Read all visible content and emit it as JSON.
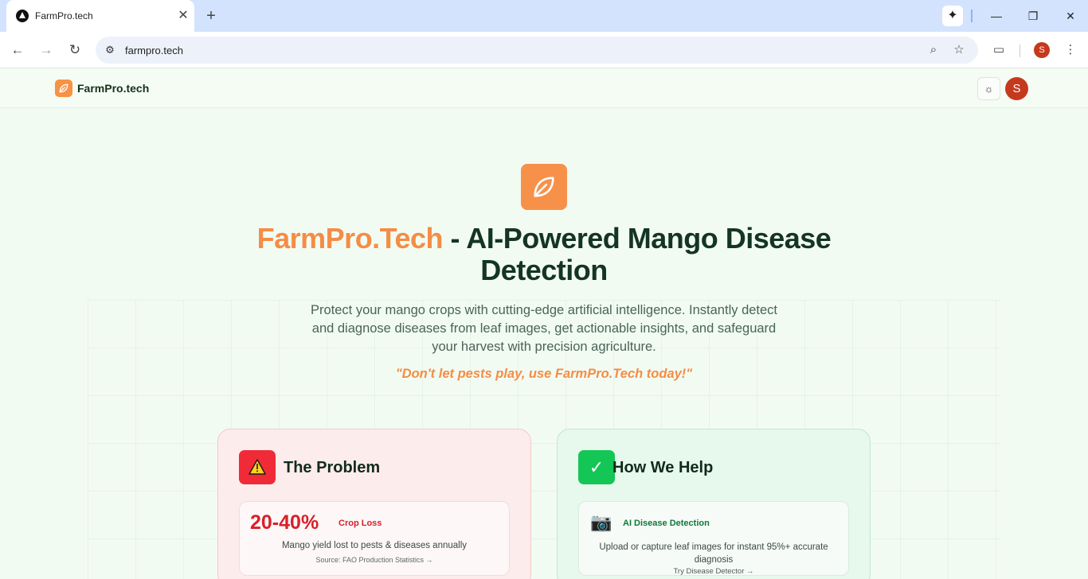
{
  "browser": {
    "tab_title": "FarmPro.tech",
    "tab_close": "✕",
    "new_tab": "+",
    "url": "farmpro.tech",
    "profile_initial": "S",
    "icons": [
      "favicon-icon",
      "close-icon",
      "plus-icon",
      "gemini-icon",
      "minimize-icon",
      "restore-icon",
      "close-window-icon",
      "back-icon",
      "forward-icon",
      "reload-icon",
      "site-info-icon",
      "zoom-icon",
      "bookmark-star-icon",
      "tab-search-icon",
      "kebab-menu-icon"
    ]
  },
  "header": {
    "brand": "FarmPro.tech",
    "avatar_initial": "S",
    "icons": [
      "leaf-icon",
      "sun-icon"
    ]
  },
  "hero": {
    "title_accent": "FarmPro.Tech",
    "title_rest": " - AI-Powered Mango Disease Detection",
    "description": "Protect your mango crops with cutting-edge artificial intelligence. Instantly detect and diagnose diseases from leaf images, get actionable insights, and safeguard your harvest with precision agriculture.",
    "quote": "\"Don't let pests play, use FarmPro.Tech today!\""
  },
  "problem": {
    "title": "The Problem",
    "stat_value": "20-40%",
    "stat_label": "Crop Loss",
    "stat_desc": "Mango yield lost to pests & diseases annually",
    "stat_source": "Source: FAO Production Statistics →"
  },
  "help": {
    "title": "How We Help",
    "icon_glyph": "✓",
    "feature_title": "AI Disease Detection",
    "feature_desc": "Upload or capture leaf images for instant 95%+ accurate diagnosis",
    "feature_link": "Try Disease Detector →"
  },
  "colors": {
    "accent_orange": "#f48d46",
    "dark_green": "#143521",
    "danger_red": "#d9202a",
    "success_green": "#14c655"
  }
}
